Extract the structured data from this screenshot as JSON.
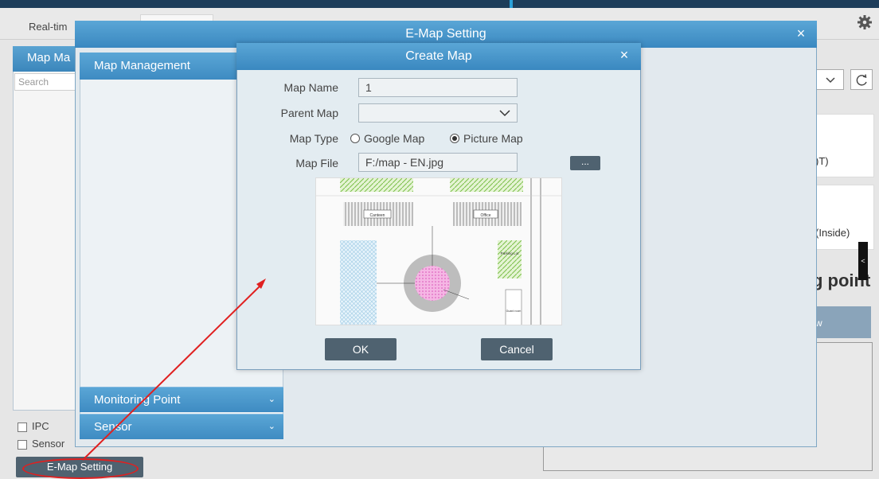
{
  "topbar": {
    "tab_label": "Real-tim"
  },
  "left_panel": {
    "header": "Map Ma",
    "search_placeholder": "Search",
    "checkboxes": [
      {
        "label": "IPC"
      },
      {
        "label": "Sensor"
      }
    ],
    "emap_button": "E-Map Setting"
  },
  "right_panel": {
    "card1_text": ")T)",
    "card2_text": "(Inside)",
    "big_text": "g point",
    "row_text": "w",
    "toggle_glyph": "<"
  },
  "emap_window": {
    "title": "E-Map Setting",
    "close": "×",
    "map_management": "Map Management",
    "monitoring_point": "Monitoring Point",
    "sensor": "Sensor",
    "chevron": "⌄"
  },
  "create_map": {
    "title": "Create Map",
    "close": "×",
    "map_name_label": "Map Name",
    "map_name_value": "1",
    "parent_map_label": "Parent Map",
    "parent_map_value": "",
    "map_type_label": "Map Type",
    "map_type_options": [
      "Google Map",
      "Picture Map"
    ],
    "map_type_selected": "Picture Map",
    "map_file_label": "Map File",
    "map_file_value": "F:/map - EN.jpg",
    "browse_label": "...",
    "ok_label": "OK",
    "cancel_label": "Cancel",
    "preview_labels": {
      "canteen": "Canteen",
      "office": "Office",
      "parking": "Parking Lot",
      "guard": "Guard room"
    }
  },
  "colors": {
    "title_bar": "#3a88c0",
    "button": "#4f6270",
    "annotation": "#e02020"
  }
}
